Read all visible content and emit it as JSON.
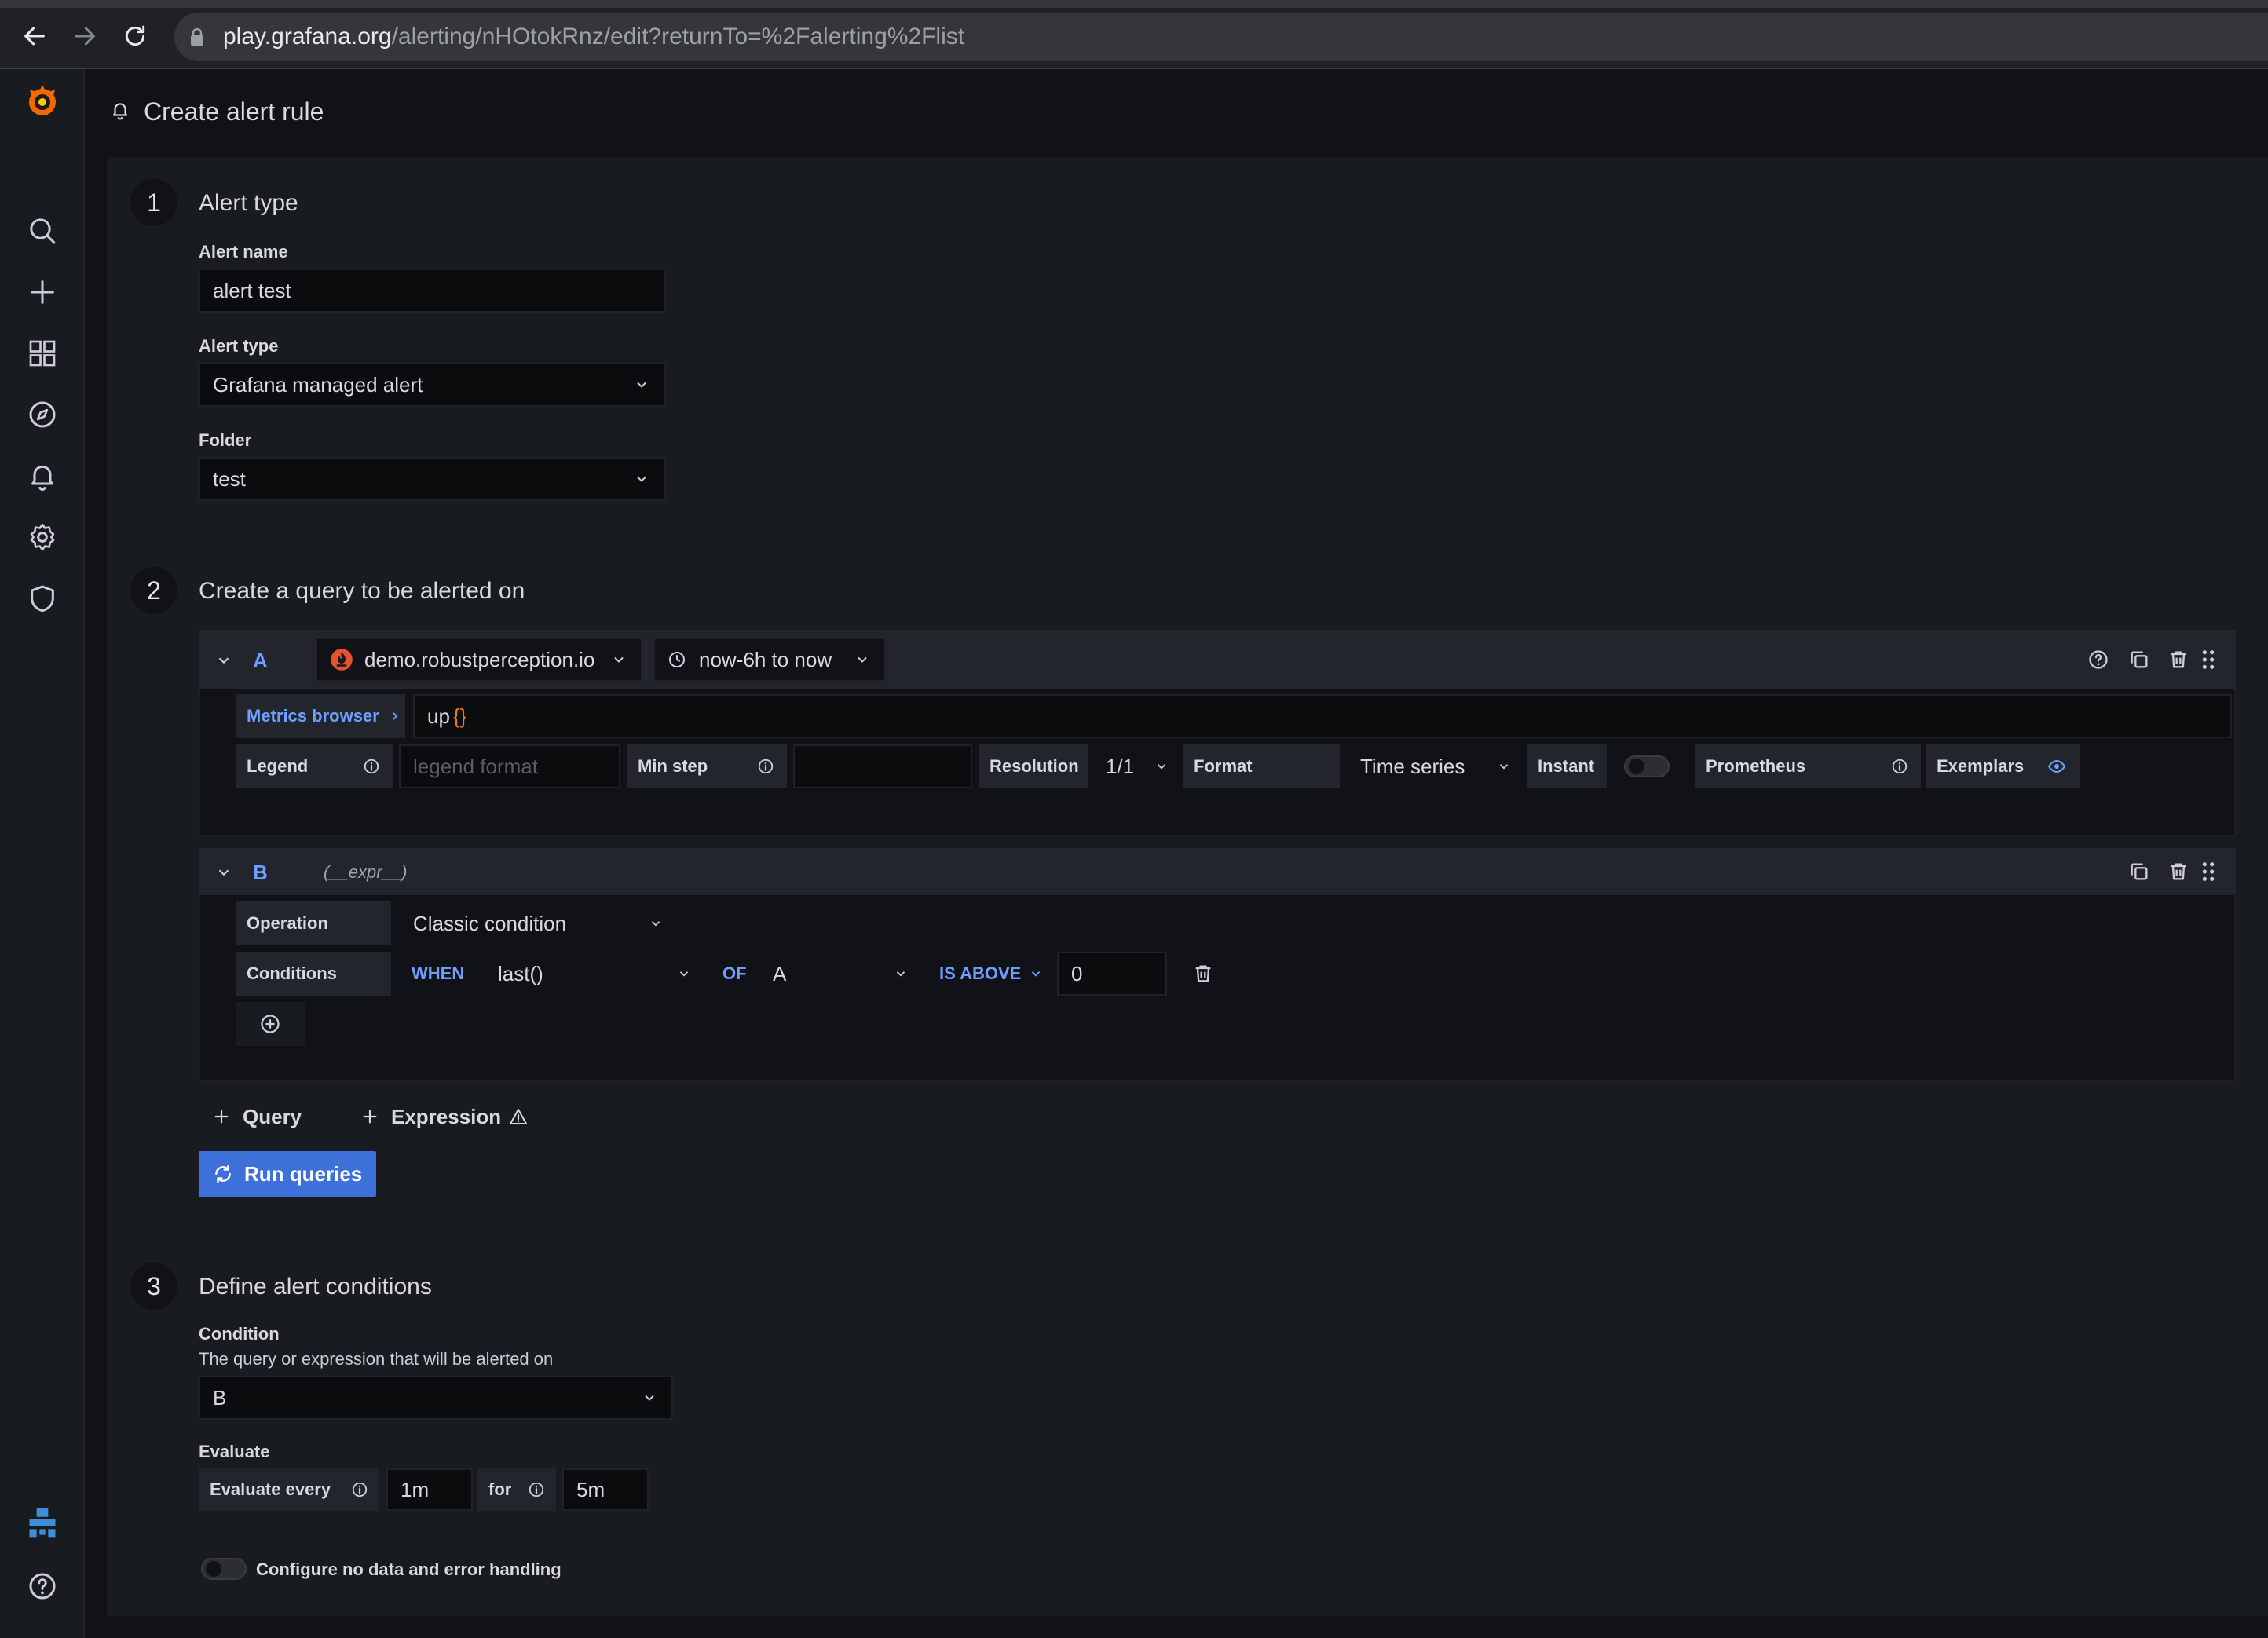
{
  "browser": {
    "url_host": "play.grafana.org",
    "url_path": "/alerting/nHOtokRnz/edit?returnTo=%2Falerting%2Flist"
  },
  "page": {
    "title": "Create alert rule"
  },
  "colors": {
    "accent": "#3d71d9",
    "link": "#6e9fff",
    "brand": "#f46800"
  },
  "step1": {
    "number": "1",
    "title": "Alert type",
    "alert_name_label": "Alert name",
    "alert_name_value": "alert test",
    "alert_type_label": "Alert type",
    "alert_type_value": "Grafana managed alert",
    "folder_label": "Folder",
    "folder_value": "test"
  },
  "step2": {
    "number": "2",
    "title": "Create a query to be alerted on",
    "query_a": {
      "ref": "A",
      "datasource": "demo.robustperception.io",
      "time_range": "now-6h to now",
      "metrics_browser": "Metrics browser",
      "expr_prefix": "up",
      "expr_braces": "{}",
      "legend_label": "Legend",
      "legend_placeholder": "legend format",
      "min_step_label": "Min step",
      "resolution_label": "Resolution",
      "resolution_value": "1/1",
      "format_label": "Format",
      "format_value": "Time series",
      "instant_label": "Instant",
      "prometheus_label": "Prometheus",
      "exemplars_label": "Exemplars"
    },
    "query_b": {
      "ref": "B",
      "expr_name": "(__expr__)",
      "operation_label": "Operation",
      "operation_value": "Classic condition",
      "conditions_label": "Conditions",
      "when": "WHEN",
      "reducer": "last()",
      "of": "OF",
      "query_ref": "A",
      "evaluator": "IS ABOVE",
      "threshold": "0"
    },
    "add_query": "Query",
    "add_expression": "Expression",
    "run_queries": "Run queries"
  },
  "step3": {
    "number": "3",
    "title": "Define alert conditions",
    "condition_label": "Condition",
    "condition_desc": "The query or expression that will be alerted on",
    "condition_value": "B",
    "evaluate_label": "Evaluate",
    "evaluate_every_label": "Evaluate every",
    "evaluate_every_value": "1m",
    "for_label": "for",
    "for_value": "5m",
    "no_data_label": "Configure no data and error handling"
  }
}
